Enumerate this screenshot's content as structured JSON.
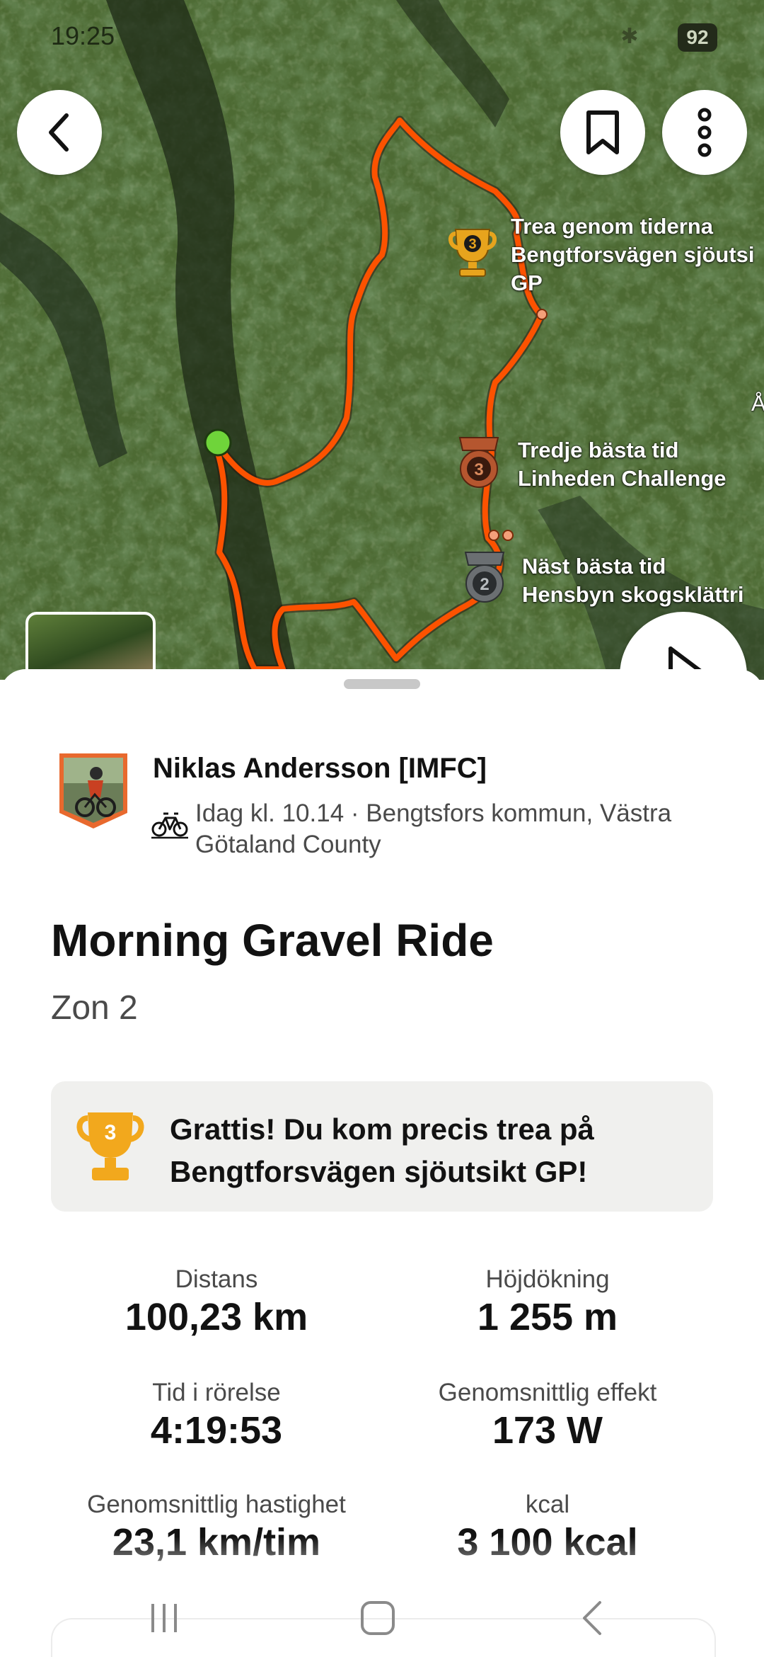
{
  "status_bar": {
    "time": "19:25",
    "battery": "92"
  },
  "map": {
    "colors": {
      "route": "#fc5200",
      "start_marker": "#6fd43a",
      "gold": "#e7a41d",
      "bronze": "#b5562f",
      "silver": "#6b6f72"
    },
    "segments": [
      {
        "icon": "gold-trophy-3-icon",
        "rank": "3",
        "lines": [
          "Trea genom tiderna",
          "Bengtforsvägen sjöutsi",
          "GP"
        ]
      },
      {
        "icon": "bronze-medal-3-icon",
        "rank": "3",
        "lines": [
          "Tredje bästa tid",
          "Linheden Challenge"
        ]
      },
      {
        "icon": "silver-medal-2-icon",
        "rank": "2",
        "lines": [
          "Näst bästa tid",
          "Hensbyn skogsklättri"
        ]
      }
    ],
    "edge_label": "Å"
  },
  "activity": {
    "athlete": "Niklas Andersson [IMFC]",
    "meta": "Idag kl. 10.14 · Bengtsfors kommun, Västra Götaland County",
    "title": "Morning Gravel Ride",
    "description": "Zon 2",
    "achievement": {
      "rank": "3",
      "text": "Grattis! Du kom precis trea på Bengtforsvägen sjöutsikt GP!"
    },
    "stats": [
      {
        "label": "Distans",
        "value": "100,23 km"
      },
      {
        "label": "Höjdökning",
        "value": "1 255 m"
      },
      {
        "label": "Tid i rörelse",
        "value": "4:19:53"
      },
      {
        "label": "Genomsnittlig effekt",
        "value": "173 W"
      },
      {
        "label": "Genomsnittlig hastighet",
        "value": "23,1 km/tim"
      },
      {
        "label": "kcal",
        "value": "3 100 kcal"
      }
    ]
  }
}
